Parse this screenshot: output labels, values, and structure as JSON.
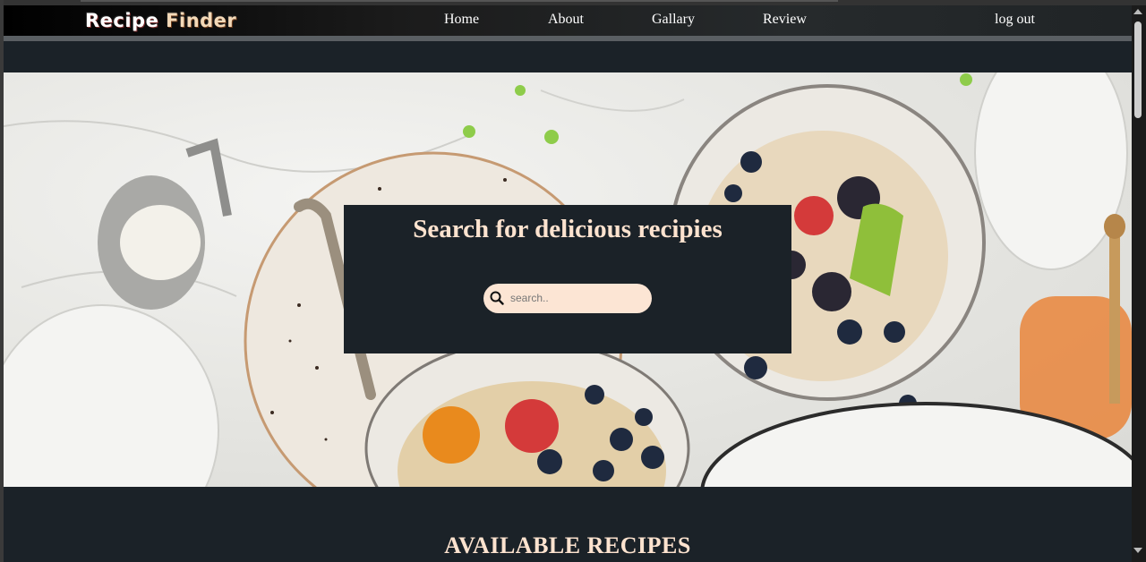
{
  "brand": {
    "word1": "Recipe",
    "word2": "Finder"
  },
  "nav": {
    "home": "Home",
    "about": "About",
    "gallary": "Gallary",
    "review": "Review",
    "logout": "log out"
  },
  "hero": {
    "title": "Search for delicious recipies",
    "search_placeholder": "search.."
  },
  "section": {
    "title": "AVAILABLE RECIPES"
  },
  "colors": {
    "page_bg": "#1b2228",
    "accent_text": "#fde3cf",
    "search_bg": "#fce5d4"
  }
}
